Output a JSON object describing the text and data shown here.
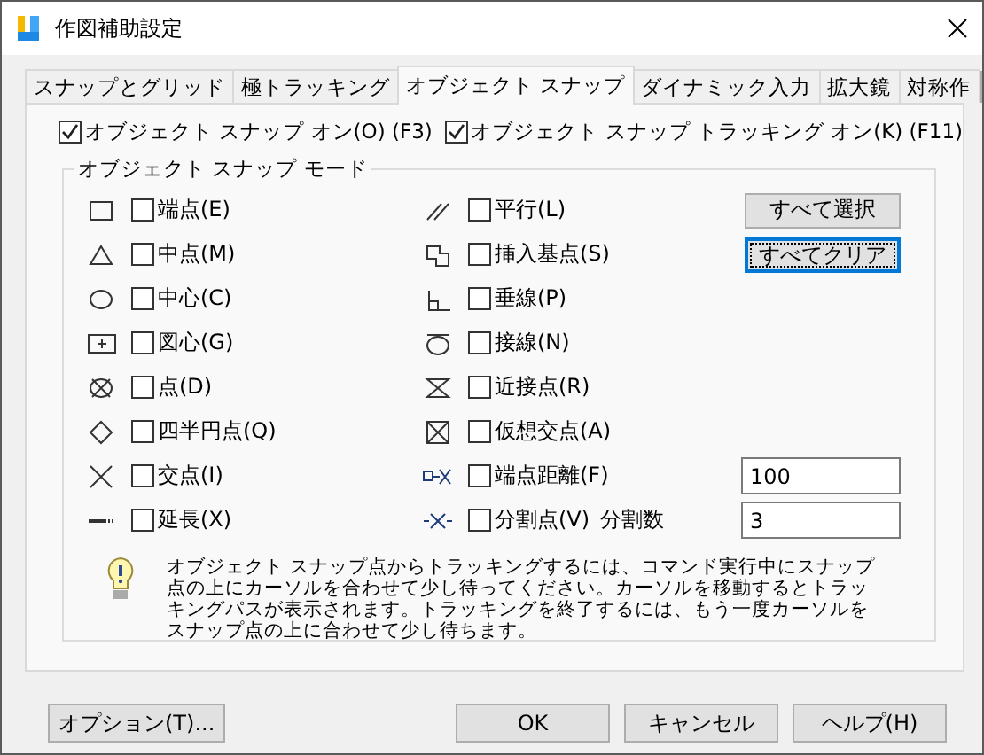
{
  "window": {
    "title": "作図補助設定"
  },
  "tabs": [
    {
      "label": "スナップとグリッド",
      "selected": false
    },
    {
      "label": "極トラッキング",
      "selected": false
    },
    {
      "label": "オブジェクト スナップ",
      "selected": true
    },
    {
      "label": "ダイナミック入力",
      "selected": false
    },
    {
      "label": "拡大鏡",
      "selected": false
    },
    {
      "label": "対称作",
      "selected": false
    }
  ],
  "master_checks": [
    {
      "label": "オブジェクト スナップ オン(O) (F3)",
      "checked": true
    },
    {
      "label": "オブジェクト スナップ トラッキング オン(K) (F11)",
      "checked": true
    }
  ],
  "group": {
    "title": "オブジェクト スナップ モード"
  },
  "snap_modes_left": [
    {
      "label": "端点(E)",
      "checked": false
    },
    {
      "label": "中点(M)",
      "checked": false
    },
    {
      "label": "中心(C)",
      "checked": false
    },
    {
      "label": "図心(G)",
      "checked": false
    },
    {
      "label": "点(D)",
      "checked": false
    },
    {
      "label": "四半円点(Q)",
      "checked": false
    },
    {
      "label": "交点(I)",
      "checked": false
    },
    {
      "label": "延長(X)",
      "checked": false
    }
  ],
  "snap_modes_right": [
    {
      "label": "平行(L)",
      "checked": false
    },
    {
      "label": "挿入基点(S)",
      "checked": false
    },
    {
      "label": "垂線(P)",
      "checked": false
    },
    {
      "label": "接線(N)",
      "checked": false
    },
    {
      "label": "近接点(R)",
      "checked": false
    },
    {
      "label": "仮想交点(A)",
      "checked": false
    },
    {
      "label": "端点距離(F)",
      "checked": false,
      "value": "100"
    },
    {
      "label": "分割点(V)",
      "checked": false,
      "field_label": "分割数",
      "value": "3"
    }
  ],
  "side_buttons": [
    {
      "label": "すべて選択",
      "focused": false
    },
    {
      "label": "すべてクリア",
      "focused": true
    }
  ],
  "info": {
    "text": "オブジェクト スナップ点からトラッキングするには、コマンド実行中にスナップ点の上にカーソルを合わせて少し待ってください。カーソルを移動するとトラッキングパスが表示されます。トラッキングを終了するには、もう一度カーソルをスナップ点の上に合わせて少し待ちます。"
  },
  "options_button": "オプション(T)...",
  "buttons": [
    "OK",
    "キャンセル",
    "ヘルプ(H)"
  ]
}
